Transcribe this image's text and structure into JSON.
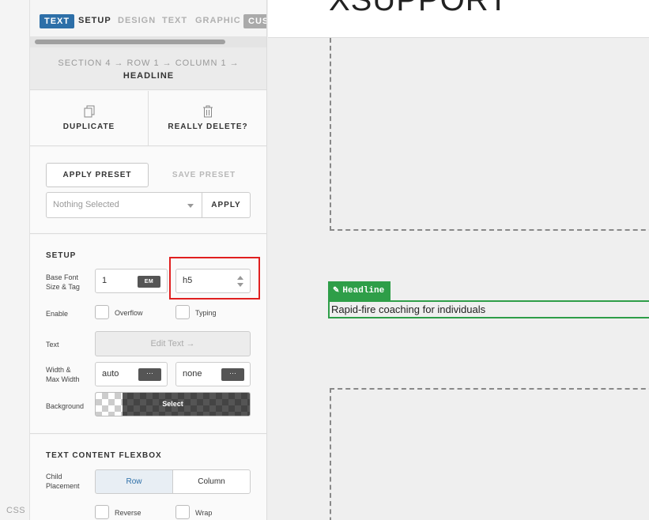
{
  "sidebar_strip": {
    "css_label": "CSS"
  },
  "tabs": [
    {
      "label": "TEXT",
      "active": true
    },
    {
      "label": "SETUP"
    },
    {
      "label": "DESIGN"
    },
    {
      "label": "TEXT"
    },
    {
      "label": "GRAPHIC"
    },
    {
      "label": "CUST"
    }
  ],
  "breadcrumb": {
    "path": "SECTION 4 → ROW 1 → COLUMN 1 →",
    "current": "HEADLINE"
  },
  "actions": {
    "duplicate": "DUPLICATE",
    "delete": "REALLY DELETE?"
  },
  "preset": {
    "apply_preset": "APPLY PRESET",
    "save_preset": "SAVE PRESET",
    "select_value": "Nothing Selected",
    "apply": "APPLY"
  },
  "setup": {
    "title": "SETUP",
    "base_font_label_1": "Base Font",
    "base_font_label_2": "Size & Tag",
    "font_size_value": "1",
    "font_unit": "EM",
    "tag_value": "h5",
    "enable_label": "Enable",
    "overflow_label": "Overflow",
    "typing_label": "Typing",
    "text_label": "Text",
    "edit_text_button": "Edit Text →",
    "width_label_1": "Width &",
    "width_label_2": "Max Width",
    "width_value": "auto",
    "max_width_value": "none",
    "dots": "···",
    "background_label": "Background",
    "background_select": "Select"
  },
  "flexbox": {
    "title": "TEXT CONTENT FLEXBOX",
    "child_label_1": "Child",
    "child_label_2": "Placement",
    "row": "Row",
    "column": "Column",
    "reverse": "Reverse",
    "wrap": "Wrap"
  },
  "canvas": {
    "page_heading": "XSUPPORT",
    "element_tag": "Headline",
    "headline_text": "Rapid-fire coaching for individuals"
  },
  "colors": {
    "accent_blue": "#2d6fa8",
    "builder_green": "#2e9e48",
    "highlight_red": "#e02020"
  }
}
